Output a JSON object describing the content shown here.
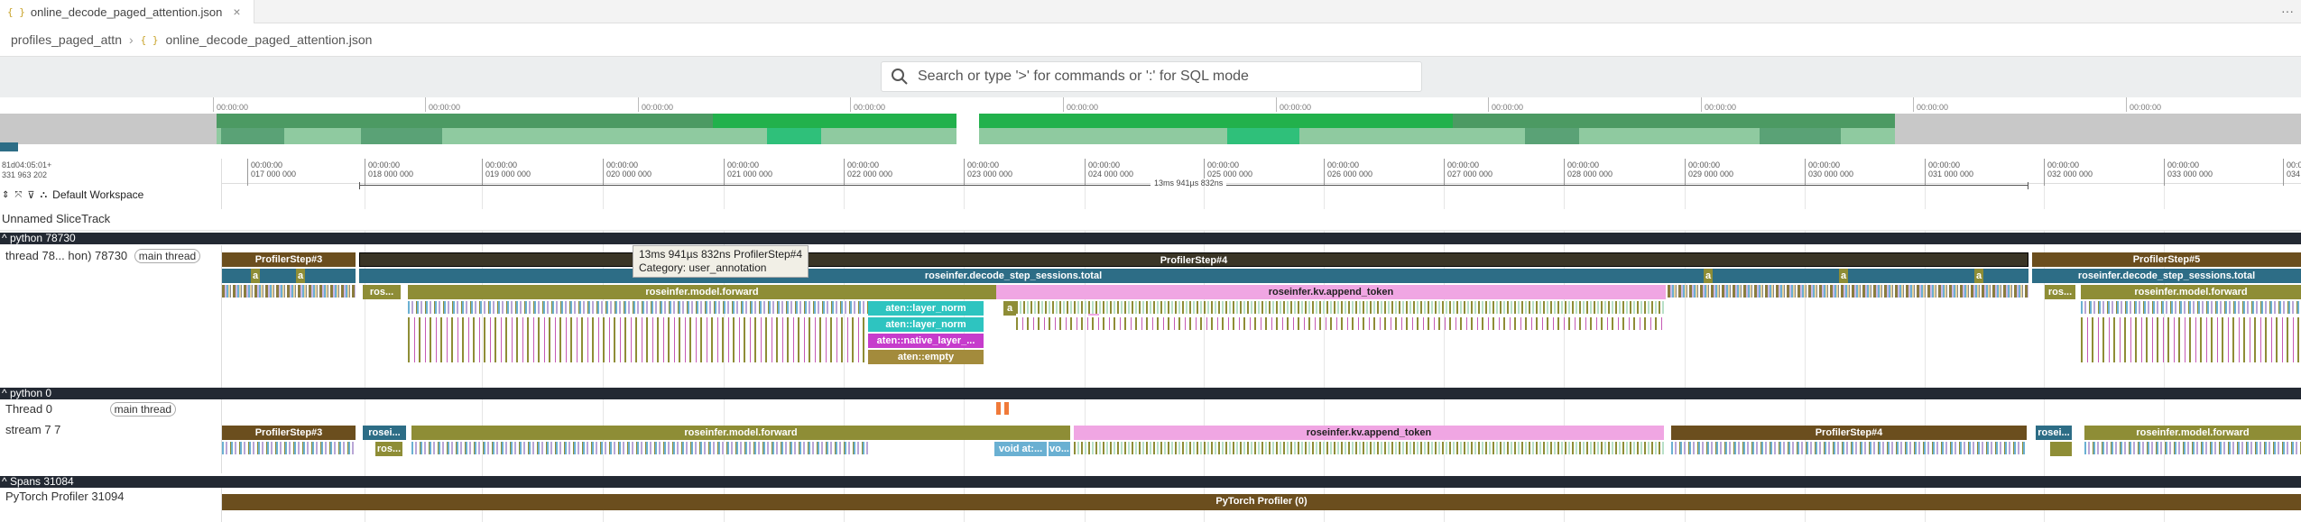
{
  "tab": {
    "label": "online_decode_paged_attention.json",
    "more": "···"
  },
  "breadcrumb": {
    "folder": "profiles_paged_attn",
    "file": "online_decode_paged_attention.json"
  },
  "omnibox": {
    "placeholder": "Search or type '>' for commands or ':' for SQL mode"
  },
  "overview_ticks": [
    "00:00:00",
    "00:00:00",
    "00:00:00",
    "00:00:00",
    "00:00:00",
    "00:00:00",
    "00:00:00",
    "00:00:00",
    "00:00:00",
    "00:00:00"
  ],
  "timestamp": {
    "line1": "81d04:05:01+",
    "line2": "331 963 202"
  },
  "time_ticks": [
    {
      "a": "00:00:00",
      "b": "017 000 000"
    },
    {
      "a": "00:00:00",
      "b": "018 000 000"
    },
    {
      "a": "00:00:00",
      "b": "019 000 000"
    },
    {
      "a": "00:00:00",
      "b": "020 000 000"
    },
    {
      "a": "00:00:00",
      "b": "021 000 000"
    },
    {
      "a": "00:00:00",
      "b": "022 000 000"
    },
    {
      "a": "00:00:00",
      "b": "023 000 000"
    },
    {
      "a": "00:00:00",
      "b": "024 000 000"
    },
    {
      "a": "00:00:00",
      "b": "025 000 000"
    },
    {
      "a": "00:00:00",
      "b": "026 000 000"
    },
    {
      "a": "00:00:00",
      "b": "027 000 000"
    },
    {
      "a": "00:00:00",
      "b": "028 000 000"
    },
    {
      "a": "00:00:00",
      "b": "029 000 000"
    },
    {
      "a": "00:00:00",
      "b": "030 000 000"
    },
    {
      "a": "00:00:00",
      "b": "031 000 000"
    },
    {
      "a": "00:00:00",
      "b": "032 000 000"
    },
    {
      "a": "00:00:00",
      "b": "033 000 000"
    },
    {
      "a": "00:00:00",
      "b": "034"
    }
  ],
  "measurement": "13ms 941µs 832ns",
  "workspace": {
    "label": "Default Workspace"
  },
  "tracks": {
    "unnamed": "Unnamed SliceTrack",
    "python1": "^ python 78730",
    "thread1": "thread 78... hon) 78730",
    "main_thread_chip": "main thread",
    "python0": "^ python 0",
    "thread0": "Thread 0",
    "stream": "stream 7 7",
    "spans": "^ Spans 31084",
    "pytorch": "PyTorch Profiler 31094"
  },
  "tooltip": {
    "line1": "13ms 941µs 832ns ProfilerStep#4",
    "line2": "Category: user_annotation"
  },
  "slices": {
    "step3": "ProfilerStep#3",
    "step4": "ProfilerStep#4",
    "step5": "ProfilerStep#5",
    "decode": "roseinfer.decode_step_sessions.total",
    "model_forward": "roseinfer.model.forward",
    "append_token": "roseinfer.kv.append_token",
    "ros_short": "ros...",
    "rosei_short": "rosei...",
    "layer_norm": "aten::layer_norm",
    "native_layer": "aten::native_layer_...",
    "empty": "aten::empty",
    "a": "a",
    "void": "void at:...",
    "vo": "vo...",
    "pytorch_profiler": "PyTorch Profiler (0)"
  }
}
